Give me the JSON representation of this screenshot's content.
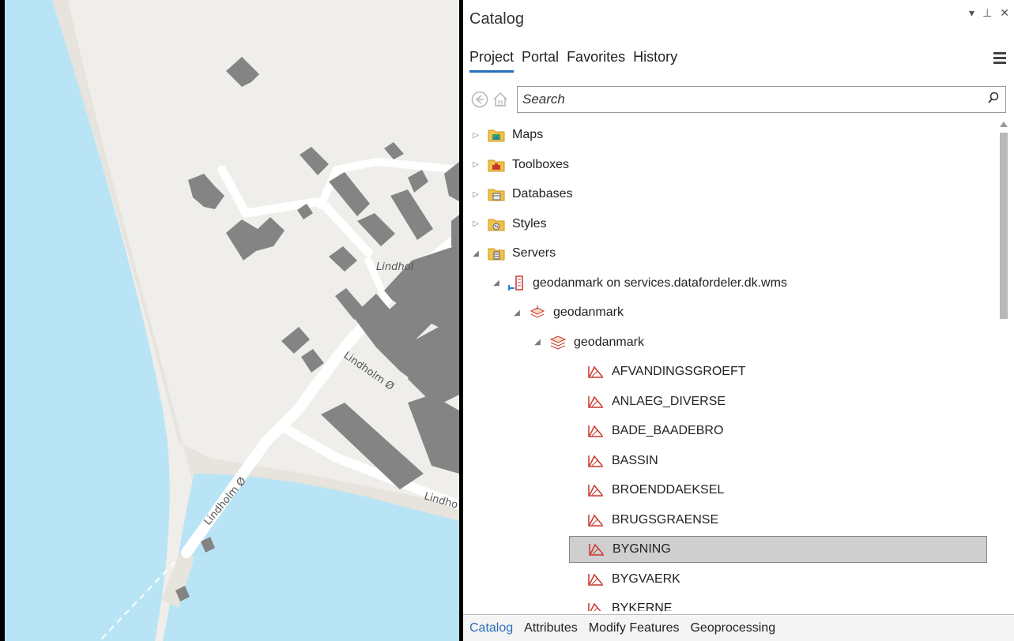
{
  "catalog": {
    "title": "Catalog",
    "controls": {
      "menu_arrow": "▾",
      "pin": "⊥",
      "close": "✕"
    },
    "tabs": [
      "Project",
      "Portal",
      "Favorites",
      "History"
    ],
    "active_tab": "Project",
    "search": {
      "placeholder": "Search",
      "value": ""
    },
    "tree": [
      {
        "label": "Maps",
        "icon": "maps-folder-icon",
        "depth": 0,
        "expanded": false
      },
      {
        "label": "Toolboxes",
        "icon": "toolboxes-folder-icon",
        "depth": 0,
        "expanded": false
      },
      {
        "label": "Databases",
        "icon": "databases-folder-icon",
        "depth": 0,
        "expanded": false
      },
      {
        "label": "Styles",
        "icon": "styles-folder-icon",
        "depth": 0,
        "expanded": false
      },
      {
        "label": "Servers",
        "icon": "servers-folder-icon",
        "depth": 0,
        "expanded": true
      },
      {
        "label": "geodanmark on services.datafordeler.dk.wms",
        "icon": "wms-server-icon",
        "depth": 1,
        "expanded": true
      },
      {
        "label": "geodanmark",
        "icon": "layer-stack-icon",
        "depth": 2,
        "expanded": true
      },
      {
        "label": "geodanmark",
        "icon": "layers-icon",
        "depth": 3,
        "expanded": true
      },
      {
        "label": "AFVANDINGSGROEFT",
        "icon": "wms-layer-icon",
        "depth": 4
      },
      {
        "label": "ANLAEG_DIVERSE",
        "icon": "wms-layer-icon",
        "depth": 4
      },
      {
        "label": "BADE_BAADEBRO",
        "icon": "wms-layer-icon",
        "depth": 4
      },
      {
        "label": "BASSIN",
        "icon": "wms-layer-icon",
        "depth": 4
      },
      {
        "label": "BROENDDAEKSEL",
        "icon": "wms-layer-icon",
        "depth": 4
      },
      {
        "label": "BRUGSGRAENSE",
        "icon": "wms-layer-icon",
        "depth": 4
      },
      {
        "label": "BYGNING",
        "icon": "wms-layer-icon",
        "depth": 4,
        "selected": true
      },
      {
        "label": "BYGVAERK",
        "icon": "wms-layer-icon",
        "depth": 4
      },
      {
        "label": "BYKERNE",
        "icon": "wms-layer-icon",
        "depth": 4
      }
    ]
  },
  "bottom_tabs": [
    "Catalog",
    "Attributes",
    "Modify Features",
    "Geoprocessing"
  ],
  "active_bottom_tab": "Catalog",
  "map": {
    "road_labels": [
      "Lindhol",
      "Lindholm Ø",
      "Lindholm Ø",
      "Lindho"
    ],
    "colors": {
      "water": "#b9e4f6",
      "land": "#efeeea",
      "shore": "#e6e4dc",
      "building": "#848484",
      "road": "#ffffff"
    }
  }
}
